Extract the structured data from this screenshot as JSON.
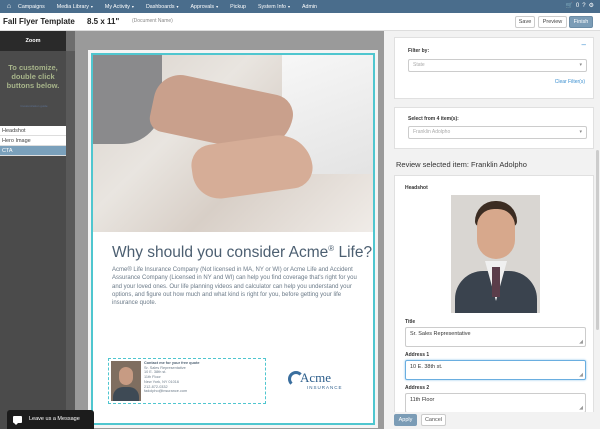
{
  "nav": {
    "home_icon": "home-icon",
    "items": [
      {
        "label": "Campaigns",
        "caret": false
      },
      {
        "label": "Media Library",
        "caret": true
      },
      {
        "label": "My Activity",
        "caret": true
      },
      {
        "label": "Dashboards",
        "caret": true
      },
      {
        "label": "Approvals",
        "caret": true
      },
      {
        "label": "Pickup",
        "caret": false
      },
      {
        "label": "System Info",
        "caret": true
      },
      {
        "label": "Admin",
        "caret": false
      }
    ],
    "cart_count": "0",
    "right_icons": [
      "cart-icon",
      "help-icon",
      "settings-icon"
    ]
  },
  "titlebar": {
    "template_name": "Fall Flyer Template",
    "size": "8.5 x 11\"",
    "document_name_placeholder": "(Document Name)",
    "save_label": "Save",
    "preview_label": "Preview",
    "finish_label": "Finish"
  },
  "sidebar": {
    "zoom_label": "Zoom",
    "instructions": "To customize, double click buttons below.",
    "link_text": "Customization guide",
    "items": [
      {
        "label": "Headshot",
        "active": false
      },
      {
        "label": "Hero Image",
        "active": false
      },
      {
        "label": "CTA",
        "active": true
      }
    ]
  },
  "flyer": {
    "headline_main": "Why should you consider Acme",
    "headline_reg": "®",
    "headline_end": " Life?",
    "body": "Acme® Life Insurance Company (Not licensed in MA, NY or WI) or Acme Life and Accident Assurance Company (Licensed in NY and WI) can help you find coverage that's right for you and your loved ones. Our life planning videos and calculator can help you understand your options, and figure out how much and what kind is right for you, before getting your life insurance quote.",
    "cta": {
      "heading": "Contact me for your free quote",
      "lines": [
        "Sr. Sales Representative",
        "10 E. 38th st.",
        "11th Floor",
        "New York, NY 01016",
        "212-872-0332",
        "fadolpho@insurance.com"
      ]
    },
    "logo": {
      "word": "Acme",
      "sub": "INSURANCE"
    }
  },
  "rpanel": {
    "filter_by_label": "Filter by:",
    "state_placeholder": "State",
    "clear_filters": "Clear Filter(s)",
    "select_from_label": "Select from 4 item(s):",
    "selected_person": "Franklin Adolpho",
    "review_title": "Review selected item: Franklin Adolpho",
    "headshot_label": "Headshot",
    "title_label": "Title",
    "title_value": "Sr. Sales Representative",
    "address1_label": "Address 1",
    "address1_value": "10 E. 38th st.",
    "address2_label": "Address 2",
    "address2_value": "11th Floor",
    "apply_label": "Apply",
    "cancel_label": "Cancel"
  },
  "chat": {
    "label": "Leave us a Message"
  },
  "colors": {
    "nav": "#4a6d8c",
    "accent": "#7b9cb6",
    "bleed": "#4fc6cf",
    "link": "#3a8fd0"
  }
}
